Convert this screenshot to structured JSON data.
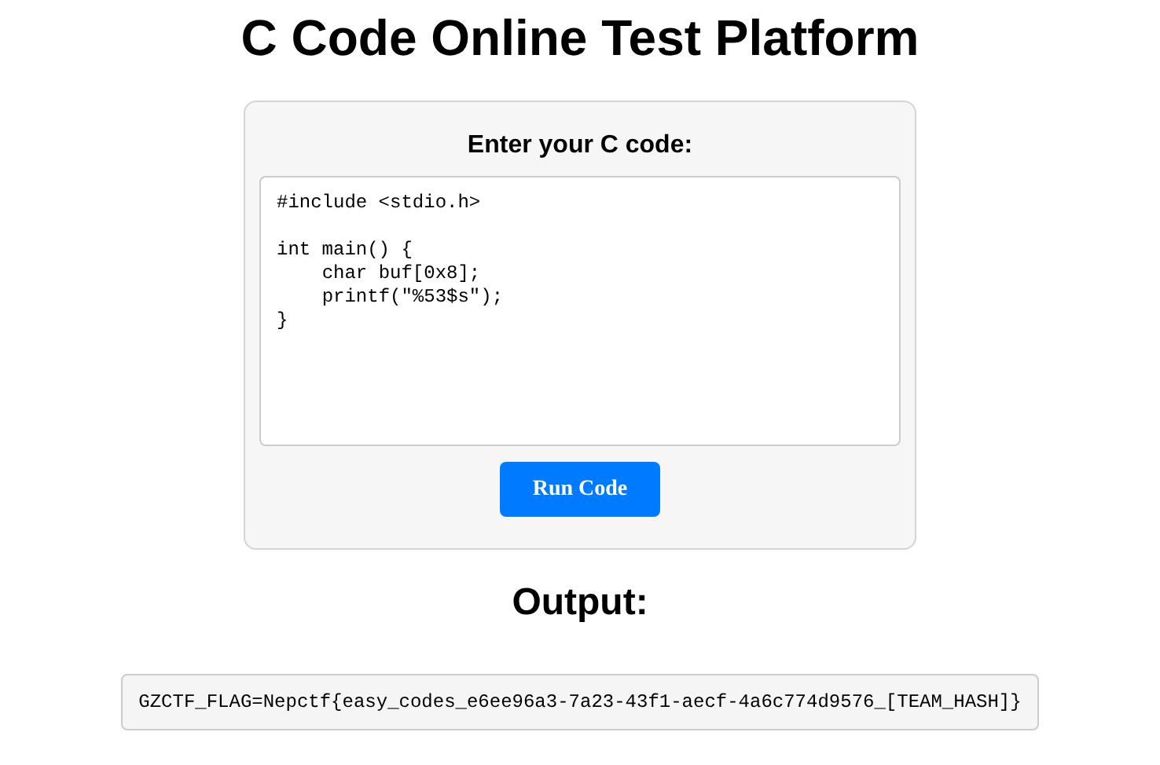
{
  "page": {
    "title": "C Code Online Test Platform"
  },
  "editor": {
    "label": "Enter your C code:",
    "value": "#include <stdio.h>\n\nint main() {\n    char buf[0x8];\n    printf(\"%53$s\");\n}",
    "button": "Run Code"
  },
  "output": {
    "heading": "Output:",
    "text": "GZCTF_FLAG=Nepctf{easy_codes_e6ee96a3-7a23-43f1-aecf-4a6c774d9576_[TEAM_HASH]}"
  }
}
